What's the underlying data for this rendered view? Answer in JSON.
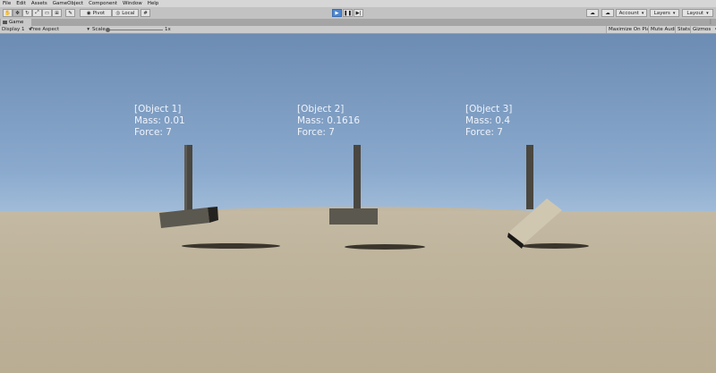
{
  "menu": [
    "File",
    "Edit",
    "Assets",
    "GameObject",
    "Component",
    "Window",
    "Help"
  ],
  "toolbar": {
    "pivot": "Pivot",
    "local": "Local",
    "account": "Account",
    "layers": "Layers",
    "layout": "Layout",
    "play_icon": "play-icon",
    "pause_icon": "pause-icon",
    "step_icon": "step-icon"
  },
  "tab": {
    "title": "Game"
  },
  "gameview": {
    "display": "Display 1",
    "aspect": "Free Aspect",
    "scale_label": "Scale",
    "scale_value": "1x",
    "maximize": "Maximize On Play",
    "mute": "Mute Audio",
    "stats": "Stats",
    "gizmos": "Gizmos"
  },
  "objects": [
    {
      "name": "[Object 1]",
      "mass": "Mass: 0.01",
      "force": "Force: 7"
    },
    {
      "name": "[Object 2]",
      "mass": "Mass: 0.1616",
      "force": "Force: 7"
    },
    {
      "name": "[Object 3]",
      "mass": "Mass: 0.4",
      "force": "Force: 7"
    }
  ],
  "colors": {
    "sky_top": "#6d8cb3",
    "sky_horizon": "#c7d8e6",
    "ground": "#bfb49c",
    "play_active": "#4f87cf",
    "hud_text": "#eef3fb"
  }
}
